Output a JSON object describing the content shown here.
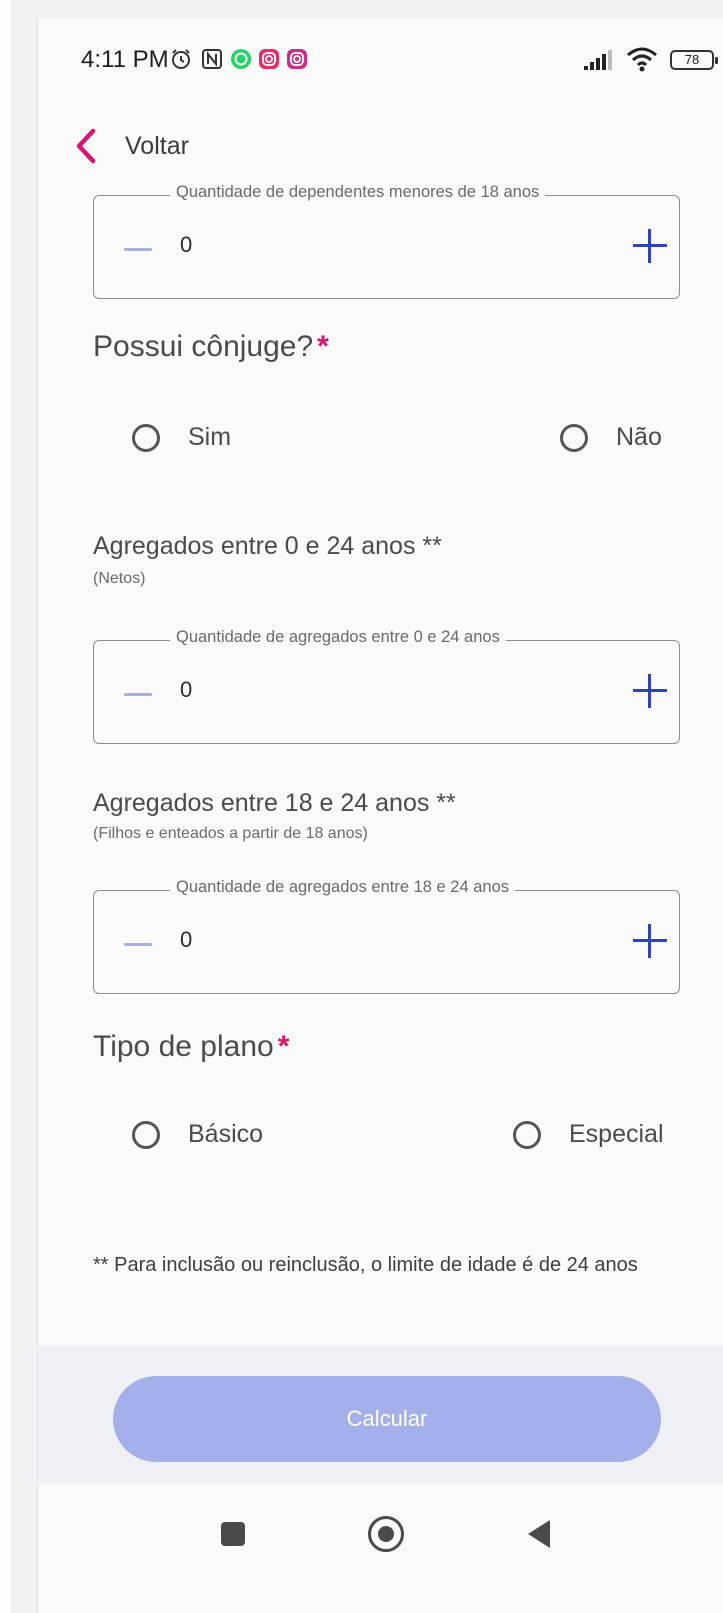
{
  "status_bar": {
    "time": "4:11 PM",
    "icons": [
      "alarm-icon",
      "nfc-icon",
      "whatsapp-icon",
      "instagram-icon",
      "instagram-icon"
    ],
    "battery": "78"
  },
  "header": {
    "back_label": "Voltar"
  },
  "dependents": {
    "label": "Quantidade de dependentes menores de 18 anos",
    "value": "0"
  },
  "spouse": {
    "question": "Possui cônjuge?",
    "required": "*",
    "options": [
      "Sim",
      "Não"
    ]
  },
  "aggregates_0_24": {
    "title": "Agregados entre 0 e 24 anos **",
    "subtitle": "(Netos)",
    "label": "Quantidade de agregados entre 0 e 24 anos",
    "value": "0"
  },
  "aggregates_18_24": {
    "title": "Agregados entre 18 e 24 anos **",
    "subtitle": "(Filhos e enteados a partir de 18 anos)",
    "label": "Quantidade de agregados entre 18 e 24 anos",
    "value": "0"
  },
  "plan": {
    "question": "Tipo de plano",
    "required": "*",
    "options": [
      "Básico",
      "Especial"
    ]
  },
  "note": "** Para inclusão ou reinclusão, o limite de idade é de 24 anos",
  "calculate_label": "Calcular",
  "colors": {
    "accent": "#d8146f",
    "primary": "#2e44b8",
    "button_disabled": "#a5b0ea",
    "minus_disabled": "#a8b1dd"
  }
}
